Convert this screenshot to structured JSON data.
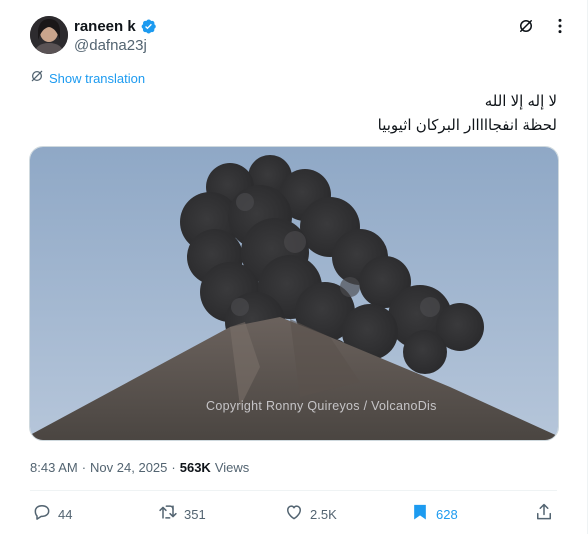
{
  "author": {
    "display_name": "raneen k",
    "handle": "@dafna23j",
    "verified": true
  },
  "translate": {
    "label": "Show translation"
  },
  "tweet": {
    "lines": [
      "لا إله إلا الله",
      "لحظة انفجااااار البركان اثيوبيا"
    ]
  },
  "media": {
    "watermark": "Copyright  Ronny Quireyos / VolcanoDis"
  },
  "meta": {
    "time": "8:43 AM",
    "separator": "·",
    "date": "Nov 24, 2025",
    "separator2": "·",
    "views_count": "563K",
    "views_label": "Views"
  },
  "actions": {
    "reply_count": "44",
    "repost_count": "351",
    "like_count": "2.5K",
    "bookmark_count": "628"
  },
  "colors": {
    "accent": "#1d9bf0",
    "muted": "#536471",
    "text": "#0f1419"
  }
}
